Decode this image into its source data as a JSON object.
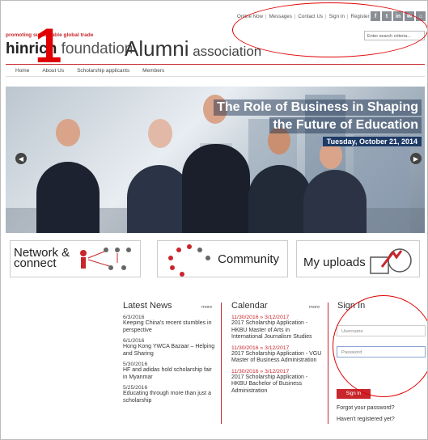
{
  "toplinks": [
    "Online Now",
    "Messages",
    "Contact Us",
    "Sign In",
    "Register"
  ],
  "social": [
    "f",
    "t",
    "in",
    "✉",
    "⌂"
  ],
  "search_placeholder": "Enter search criteria...",
  "brand": {
    "tagline": "promoting sustainable global trade",
    "foundation_bold": "hinrich",
    "foundation_rest": " foundation",
    "alumni": "Alumni",
    "association": " association"
  },
  "annotation_number": "1",
  "nav": [
    "Home",
    "About Us",
    "Scholarship applicants",
    "Members"
  ],
  "hero": {
    "line1": "The Role of Business in Shaping",
    "line2": "the Future of Education",
    "date": "Tuesday, October 21, 2014"
  },
  "tiles": {
    "network_line1": "Network &",
    "network_line2": "connect",
    "community": "Community",
    "uploads": "My uploads"
  },
  "news": {
    "title": "Latest News",
    "more": "more",
    "items": [
      {
        "date": "6/3/2016",
        "title": "Keeping China's recent stumbles in perspective"
      },
      {
        "date": "6/1/2016",
        "title": "Hong Kong YWCA Bazaar – Helping and Sharing"
      },
      {
        "date": "5/30/2016",
        "title": "HF and adidas hold scholarship fair in Myanmar"
      },
      {
        "date": "5/25/2016",
        "title": "Educating through more than just a scholarship"
      }
    ]
  },
  "calendar": {
    "title": "Calendar",
    "more": "more",
    "items": [
      {
        "date": "11/30/2016 » 3/12/2017",
        "title": "2017 Scholarship Application - HKBU Master of Arts in International Journalism Studies"
      },
      {
        "date": "11/30/2016 » 3/12/2017",
        "title": "2017 Scholarship Application - VGU Master of Business Administration"
      },
      {
        "date": "11/30/2016 » 3/12/2017",
        "title": "2017 Scholarship Application - HKBU Bachelor of Business Administration"
      }
    ]
  },
  "signin": {
    "title": "Sign In",
    "username_placeholder": "Username",
    "password_placeholder": "Password",
    "button": "Sign In",
    "forgot": "Forgot your password?",
    "not_registered": "Haven't registered yet?"
  },
  "colors": {
    "accent": "#c8262c",
    "annotation": "#e00000"
  }
}
